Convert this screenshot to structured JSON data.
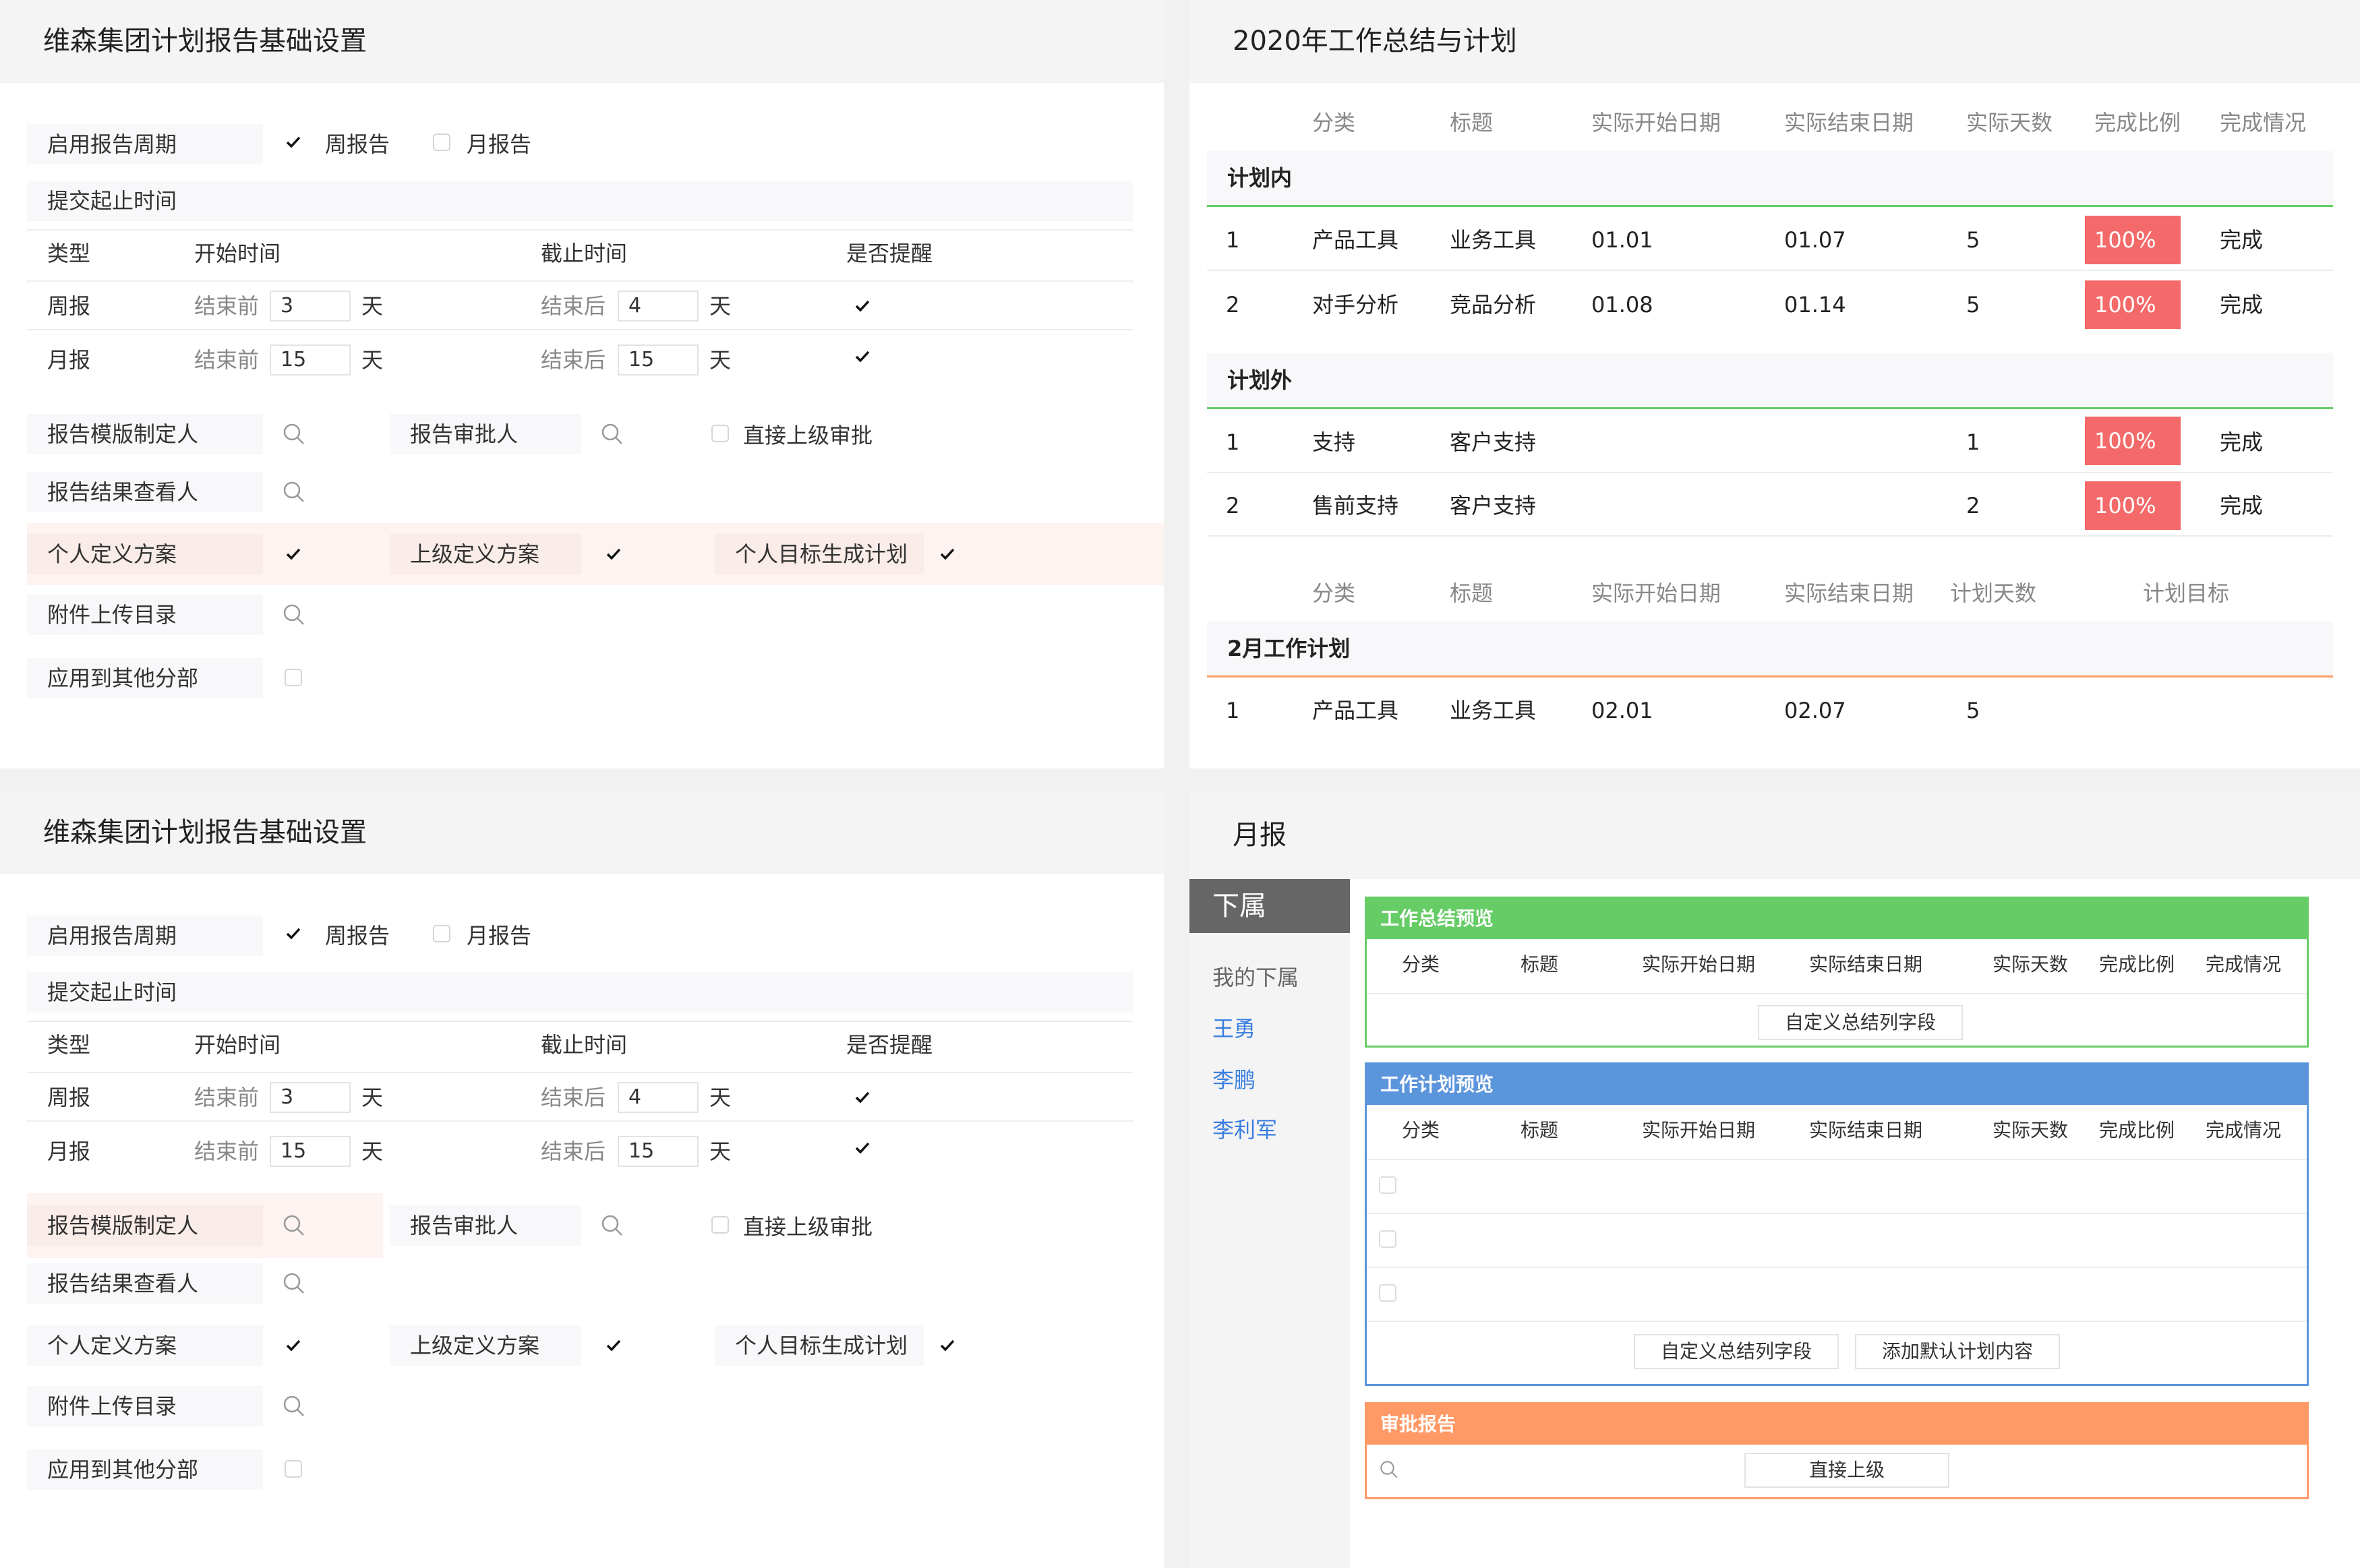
{
  "settings": {
    "title": "维森集团计划报告基础设置",
    "cycle_label": "启用报告周期",
    "weekly": "周报告",
    "monthly": "月报告",
    "submit_label": "提交起止时间",
    "cols": {
      "type": "类型",
      "start": "开始时间",
      "end": "截止时间",
      "remind": "是否提醒"
    },
    "rows": [
      {
        "type": "周报",
        "before": "结束前",
        "start_val": "3",
        "after": "结束后",
        "end_val": "4",
        "unit": "天"
      },
      {
        "type": "月报",
        "before": "结束前",
        "start_val": "15",
        "after": "结束后",
        "end_val": "15",
        "unit": "天"
      }
    ],
    "template_owner": "报告模版制定人",
    "approver": "报告审批人",
    "direct_approve": "直接上级审批",
    "viewer": "报告结果查看人",
    "personal_plan": "个人定义方案",
    "superior_plan": "上级定义方案",
    "goal_plan": "个人目标生成计划",
    "attach_dir": "附件上传目录",
    "apply_others": "应用到其他分部"
  },
  "summary": {
    "title": "2020年工作总结与计划",
    "headers": [
      "分类",
      "标题",
      "实际开始日期",
      "实际结束日期",
      "实际天数",
      "完成比例",
      "完成情况"
    ],
    "in_plan_label": "计划内",
    "in_plan": [
      {
        "no": "1",
        "cat": "产品工具",
        "title": "业务工具",
        "start": "01.01",
        "end": "01.07",
        "days": "5",
        "pct": "100%",
        "status": "完成"
      },
      {
        "no": "2",
        "cat": "对手分析",
        "title": "竞品分析",
        "start": "01.08",
        "end": "01.14",
        "days": "5",
        "pct": "100%",
        "status": "完成"
      }
    ],
    "out_plan_label": "计划外",
    "out_plan": [
      {
        "no": "1",
        "cat": "支持",
        "title": "客户支持",
        "days": "1",
        "pct": "100%",
        "status": "完成"
      },
      {
        "no": "2",
        "cat": "售前支持",
        "title": "客户支持",
        "days": "2",
        "pct": "100%",
        "status": "完成"
      }
    ],
    "plan_headers": [
      "分类",
      "标题",
      "实际开始日期",
      "实际结束日期",
      "计划天数",
      "计划目标"
    ],
    "feb_label": "2月工作计划",
    "feb": [
      {
        "no": "1",
        "cat": "产品工具",
        "title": "业务工具",
        "start": "02.01",
        "end": "02.07",
        "days": "5"
      }
    ]
  },
  "monthly": {
    "title": "月报",
    "sidebar_header": "下属",
    "my_subordinates": "我的下属",
    "people": [
      "王勇",
      "李鹏",
      "李利军"
    ],
    "summary_card": "工作总结预览",
    "plan_card": "工作计划预览",
    "approve_card": "审批报告",
    "cols": [
      "分类",
      "标题",
      "实际开始日期",
      "实际结束日期",
      "实际天数",
      "完成比例",
      "完成情况"
    ],
    "custom_fields_btn": "自定义总结列字段",
    "add_default_btn": "添加默认计划内容",
    "direct_superior_btn": "直接上级",
    "colors": {
      "green": "#66cc66",
      "blue": "#5b95dc",
      "orange": "#ff9966",
      "sidebar": "#666666",
      "link": "#3a7ee0"
    }
  }
}
